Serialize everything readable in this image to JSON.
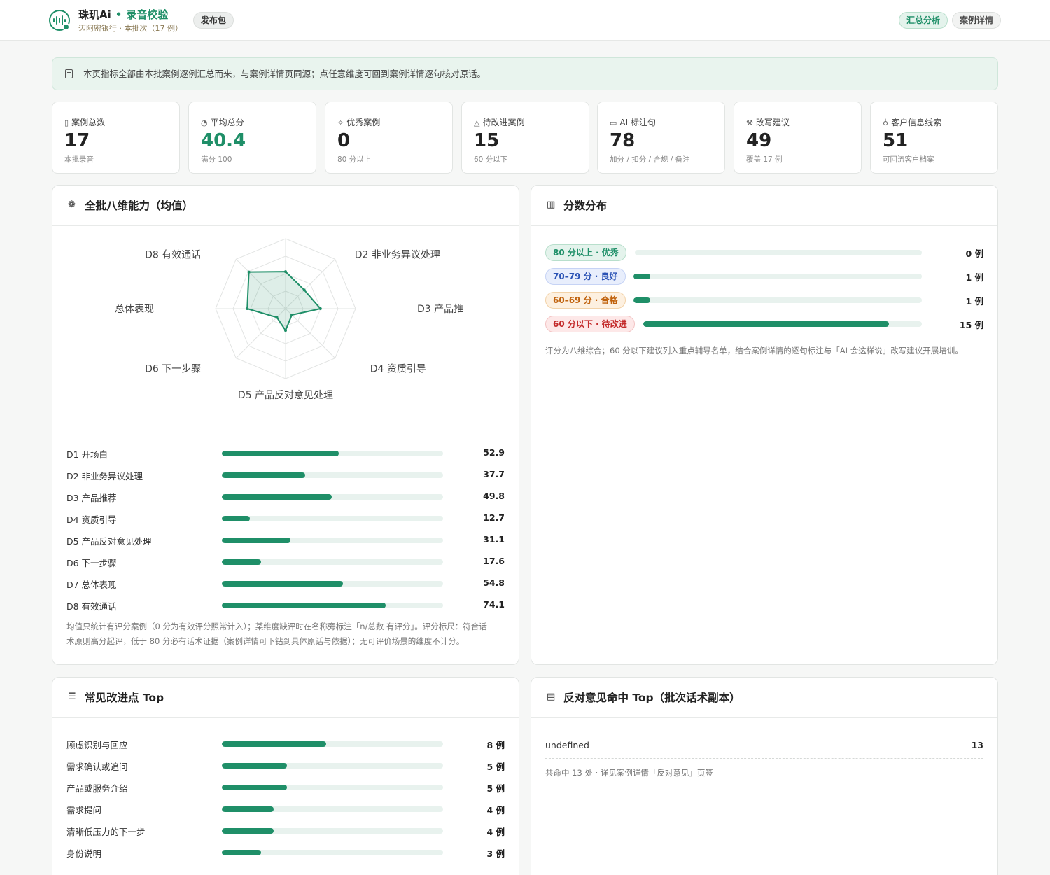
{
  "header": {
    "brand": "珠玑Ai",
    "module": "录音校验",
    "org": "迈阿密银行",
    "batch": "本批次（17 例）",
    "publish_label": "发布包",
    "nav": [
      {
        "label": "汇总分析",
        "active": true
      },
      {
        "label": "案例详情",
        "active": false
      }
    ]
  },
  "notice": "本页指标全部由本批案例逐例汇总而来，与案例详情页同源；点任意维度可回到案例详情逐句核对原话。",
  "stats": [
    {
      "label": "案例总数",
      "value": "17",
      "sub": "本批录音",
      "icon": "doc-icon"
    },
    {
      "label": "平均总分",
      "value": "40.4",
      "sub": "满分 100",
      "icon": "gauge-icon"
    },
    {
      "label": "优秀案例",
      "value": "0",
      "sub": "80 分以上",
      "icon": "sparkle-icon"
    },
    {
      "label": "待改进案例",
      "value": "15",
      "sub": "60 分以下",
      "icon": "warning-icon"
    },
    {
      "label": "AI 标注句",
      "value": "78",
      "sub": "加分 / 扣分 / 合规 / 备注",
      "icon": "message-icon"
    },
    {
      "label": "改写建议",
      "value": "49",
      "sub": "覆盖 17 例",
      "icon": "wand-icon"
    },
    {
      "label": "客户信息线索",
      "value": "51",
      "sub": "可回流客户档案",
      "icon": "bulb-icon"
    }
  ],
  "radar_card": {
    "title": "全批八维能力（均值）",
    "icon": "radar-icon",
    "axis_labels": [
      "D1 开场白",
      "D2 非业务异议处理",
      "D3 产品推",
      "D4 资质引导",
      "D5 产品反对意见处理",
      "D6 下一步骤",
      "总体表现",
      "D8 有效通话"
    ],
    "rows": [
      {
        "name": "D1 开场白",
        "value": 52.9
      },
      {
        "name": "D2 非业务异议处理",
        "value": 37.7
      },
      {
        "name": "D3 产品推荐",
        "value": 49.8
      },
      {
        "name": "D4 资质引导",
        "value": 12.7
      },
      {
        "name": "D5 产品反对意见处理",
        "value": 31.1
      },
      {
        "name": "D6 下一步骤",
        "value": 17.6
      },
      {
        "name": "D7 总体表现",
        "value": 54.8
      },
      {
        "name": "D8 有效通话",
        "value": 74.1
      }
    ],
    "note_line1": "均值只统计有评分案例（0 分为有效评分照常计入）；某维度缺评时在名称旁标注「n/总数 有评分」。评分标尺：符合话",
    "note_line2": "术原则高分起评，低于 80 分必有话术证据（案例详情可下钻到具体原话与依据）；无可评价场景的维度不计分。"
  },
  "chart_data": {
    "type": "radar",
    "categories": [
      "D1 开场白",
      "D2 非业务异议处理",
      "D3 产品推",
      "D4 资质引导",
      "D5 产品反对意见处理",
      "D6 下一步骤",
      "总体表现",
      "D8 有效通话"
    ],
    "values": [
      52.9,
      37.7,
      49.8,
      12.7,
      31.1,
      17.6,
      54.8,
      74.1
    ],
    "ylim": [
      0,
      100
    ],
    "grid": true
  },
  "dist_card": {
    "title": "分数分布",
    "icon": "bar-chart-icon",
    "rows": [
      {
        "label": "80 分以上 · 优秀",
        "count": 0,
        "count_label": "0 例",
        "style": "t-green"
      },
      {
        "label": "70–79 分 · 良好",
        "count": 1,
        "count_label": "1 例",
        "style": "t-blue"
      },
      {
        "label": "60–69 分 · 合格",
        "count": 1,
        "count_label": "1 例",
        "style": "t-orange"
      },
      {
        "label": "60 分以下 · 待改进",
        "count": 15,
        "count_label": "15 例",
        "style": "t-red"
      }
    ],
    "total": 17,
    "note": "评分为八维综合；60 分以下建议列入重点辅导名单，结合案例详情的逐句标注与「AI 会这样说」改写建议开展培训。"
  },
  "improve_card": {
    "title": "常见改进点 Top",
    "icon": "list-check-icon",
    "max": 17,
    "rows": [
      {
        "name": "顾虑识别与回应",
        "count": 8,
        "count_label": "8 例"
      },
      {
        "name": "需求确认或追问",
        "count": 5,
        "count_label": "5 例"
      },
      {
        "name": "产品或服务介绍",
        "count": 5,
        "count_label": "5 例"
      },
      {
        "name": "需求提问",
        "count": 4,
        "count_label": "4 例"
      },
      {
        "name": "清晰低压力的下一步",
        "count": 4,
        "count_label": "4 例"
      },
      {
        "name": "身份说明",
        "count": 3,
        "count_label": "3 例"
      }
    ]
  },
  "objection_card": {
    "title": "反对意见命中 Top（批次话术副本）",
    "icon": "chat-icon",
    "rows": [
      {
        "name": "undefined",
        "count": "13"
      }
    ],
    "note": "共命中 13 处 · 详见案例详情「反对意见」页签"
  },
  "colors": {
    "accent": "#1f8f68",
    "track": "#e8f2ee"
  }
}
